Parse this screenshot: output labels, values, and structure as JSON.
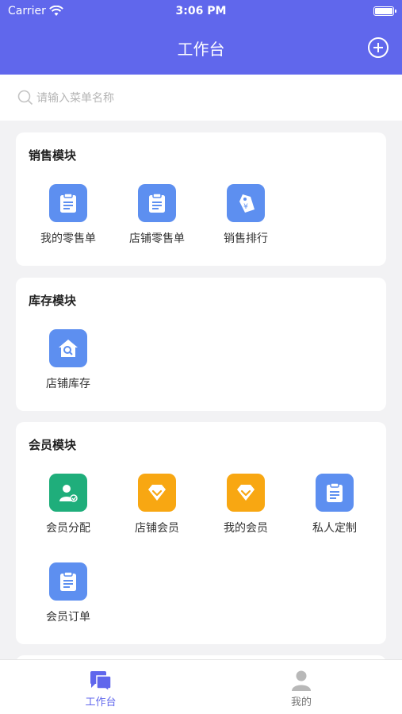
{
  "status_bar": {
    "carrier": "Carrier",
    "time": "3:06 PM"
  },
  "header": {
    "title": "工作台"
  },
  "search": {
    "placeholder": "请输入菜单名称"
  },
  "sections": [
    {
      "title": "销售模块",
      "items": [
        {
          "label": "我的零售单",
          "icon": "clipboard-icon",
          "color": "#5d8ff0"
        },
        {
          "label": "店铺零售单",
          "icon": "clipboard-icon",
          "color": "#5d8ff0"
        },
        {
          "label": "销售排行",
          "icon": "price-tag-icon",
          "color": "#5d8ff0"
        }
      ]
    },
    {
      "title": "库存模块",
      "items": [
        {
          "label": "店铺库存",
          "icon": "house-search-icon",
          "color": "#5d8ff0"
        }
      ]
    },
    {
      "title": "会员模块",
      "items": [
        {
          "label": "会员分配",
          "icon": "member-assign-icon",
          "color": "#1fae7b"
        },
        {
          "label": "店铺会员",
          "icon": "diamond-icon",
          "color": "#f8a712"
        },
        {
          "label": "我的会员",
          "icon": "diamond-icon",
          "color": "#f8a712"
        },
        {
          "label": "私人定制",
          "icon": "clipboard-icon",
          "color": "#5d8ff0"
        },
        {
          "label": "会员订单",
          "icon": "clipboard-icon",
          "color": "#5d8ff0"
        }
      ]
    }
  ],
  "tabbar": [
    {
      "label": "工作台",
      "icon": "chat-bubbles-icon",
      "active": true
    },
    {
      "label": "我的",
      "icon": "person-icon",
      "active": false
    }
  ],
  "colors": {
    "brand": "#6067ec",
    "blue_tile": "#5d8ff0",
    "orange_tile": "#f8a712",
    "green_tile": "#1fae7b"
  }
}
